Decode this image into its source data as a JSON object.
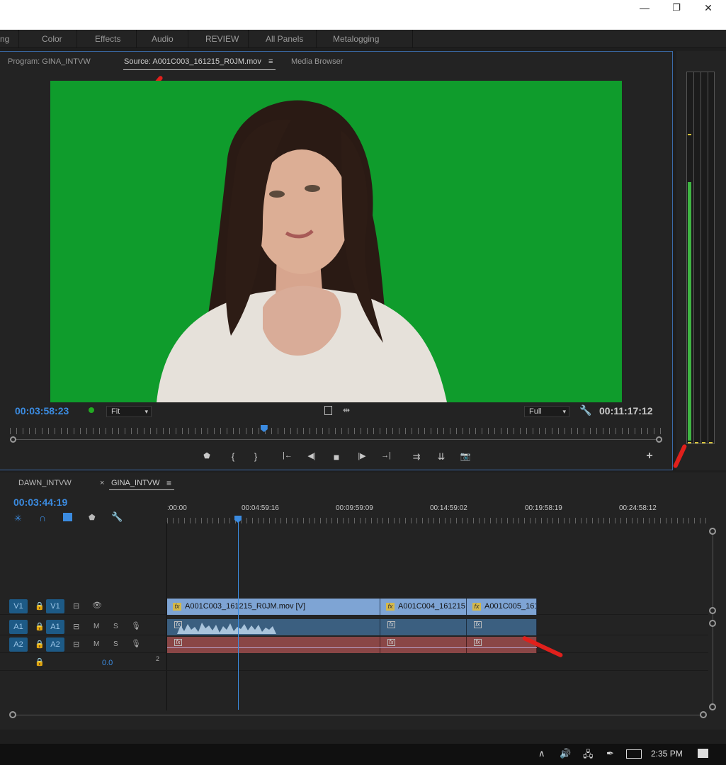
{
  "window": {
    "min": "—",
    "restore": "❐",
    "close": "✕"
  },
  "workspaces": [
    "ng",
    "Color",
    "Effects",
    "Audio",
    "REVIEW",
    "All Panels",
    "Metalogging"
  ],
  "monitor": {
    "tabs": {
      "program": "Program: GINA_INTVW",
      "source": "Source: A001C003_161215_R0JM.mov",
      "source_menu": "≡",
      "media_browser": "Media Browser"
    },
    "playhead_timecode": "00:03:58:23",
    "fit_select": "Fit",
    "quality_select": "Full",
    "duration_timecode": "00:11:17:12",
    "scrub_progress": 0.39
  },
  "controls": {
    "marker": "⬟",
    "mark_in": "{",
    "mark_out": "}",
    "go_in": "|←",
    "step_back": "◀|",
    "stop": "■",
    "step_fwd": "|▶",
    "go_out": "→|",
    "insert": "⇉",
    "overwrite": "⇊",
    "export_frame": "📷",
    "add": "+"
  },
  "timeline": {
    "tabs": [
      {
        "label": "DAWN_INTVW"
      },
      {
        "label": "GINA_INTVW",
        "close": "×",
        "menu": "≡"
      }
    ],
    "timecode": "00:03:44:19",
    "ruler": [
      ":00:00",
      "00:04:59:16",
      "00:09:59:09",
      "00:14:59:02",
      "00:19:58:19",
      "00:24:58:12"
    ],
    "tracks": {
      "v1": {
        "src": "V1",
        "tgt": "V1"
      },
      "a1": {
        "src": "A1",
        "tgt": "A1",
        "m": "M",
        "s": "S"
      },
      "a2": {
        "src": "A2",
        "tgt": "A2",
        "m": "M",
        "s": "S"
      },
      "master": {
        "value": "0.0",
        "ch": "2"
      }
    },
    "clips": {
      "v1": [
        "A001C003_161215_R0JM.mov [V]",
        "A001C004_161215",
        "A001C005_161"
      ],
      "fx_badge": "fx"
    }
  },
  "taskbar": {
    "time": "2:35 PM",
    "chevron": "∧"
  },
  "colors": {
    "accent": "#3b8be0",
    "screen_green": "#0f9c2c",
    "video_clip": "#7ea4d4",
    "audio_clip_a1": "#3b5f80",
    "audio_clip_a2": "#8a4646",
    "annotation_red": "#e0201c"
  }
}
